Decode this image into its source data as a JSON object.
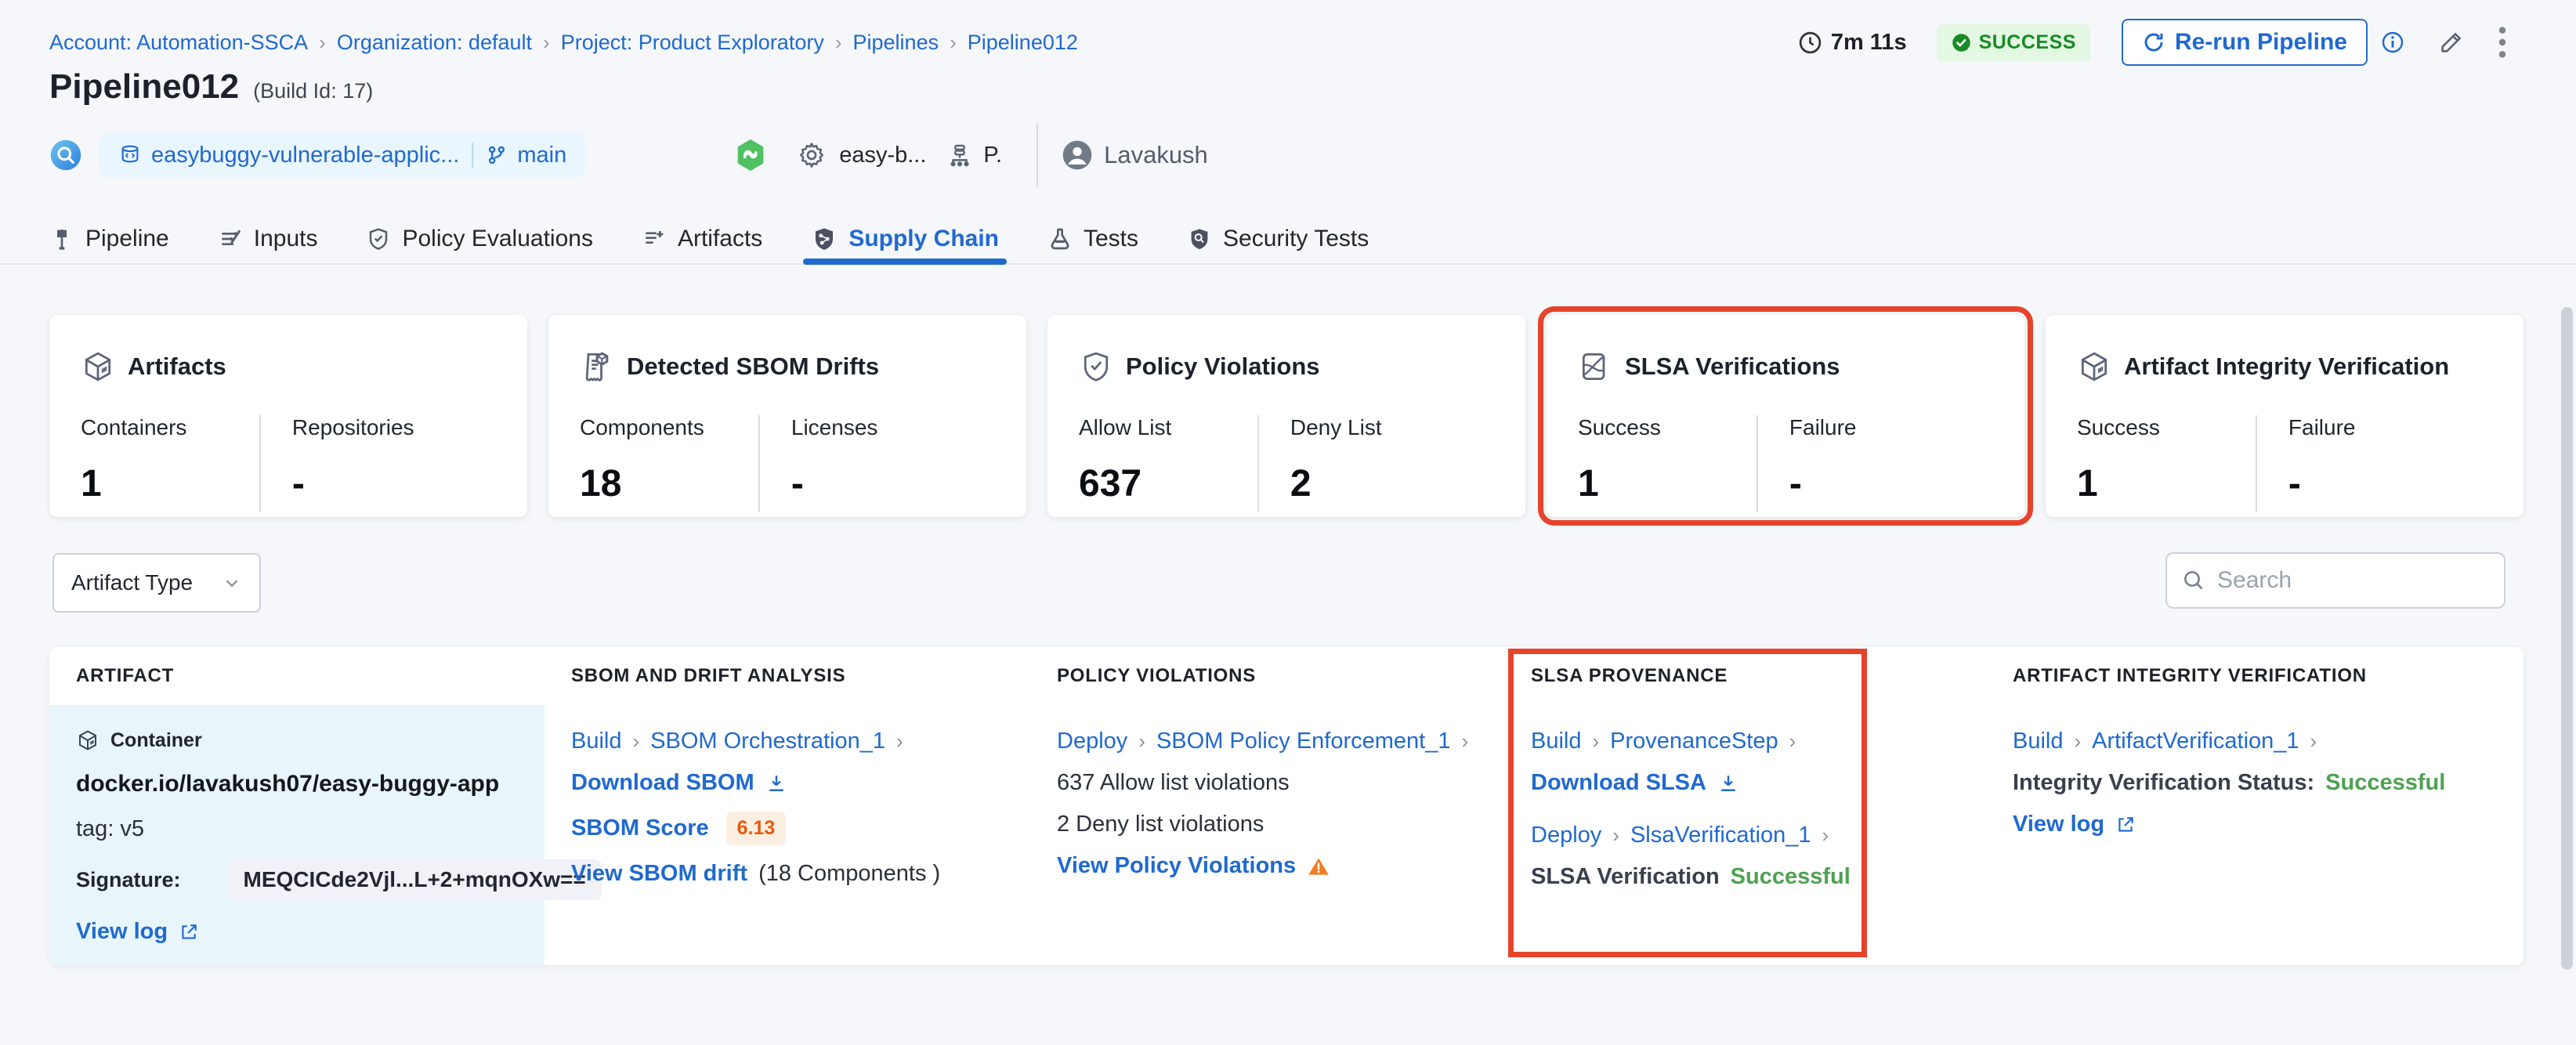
{
  "colors": {
    "highlight_red": "#e5442b",
    "link_blue": "#2069cf",
    "success_badge_green": "#188a26",
    "status_green": "#4ea152",
    "score_orange": "#e8590c",
    "artifact_cell_bg": "#e8f6fb"
  },
  "header": {
    "breadcrumb": [
      {
        "label": "Account: Automation-SSCA"
      },
      {
        "label": "Organization: default"
      },
      {
        "label": "Project: Product Exploratory"
      },
      {
        "label": "Pipelines"
      },
      {
        "label": "Pipeline012"
      }
    ],
    "duration": "7m 11s",
    "status_badge": "SUCCESS",
    "rerun_button": "Re-run Pipeline",
    "title": "Pipeline012",
    "build_id": "(Build Id: 17)",
    "repo": {
      "name": "easybuggy-vulnerable-applic...",
      "branch": "main"
    },
    "execution": {
      "pipeline_short": "easy-b...",
      "project_short": "P.",
      "user": "Lavakush"
    }
  },
  "tabs": [
    {
      "label": "Pipeline"
    },
    {
      "label": "Inputs"
    },
    {
      "label": "Policy Evaluations"
    },
    {
      "label": "Artifacts"
    },
    {
      "label": "Supply Chain"
    },
    {
      "label": "Tests"
    },
    {
      "label": "Security Tests"
    }
  ],
  "summary_cards": [
    {
      "title": "Artifacts",
      "stats": [
        {
          "label": "Containers",
          "value": "1"
        },
        {
          "label": "Repositories",
          "value": "-"
        }
      ]
    },
    {
      "title": "Detected SBOM Drifts",
      "stats": [
        {
          "label": "Components",
          "value": "18"
        },
        {
          "label": "Licenses",
          "value": "-"
        }
      ]
    },
    {
      "title": "Policy Violations",
      "stats": [
        {
          "label": "Allow List",
          "value": "637"
        },
        {
          "label": "Deny List",
          "value": "2"
        }
      ]
    },
    {
      "title": "SLSA Verifications",
      "highlighted": true,
      "stats": [
        {
          "label": "Success",
          "value": "1"
        },
        {
          "label": "Failure",
          "value": "-"
        }
      ]
    },
    {
      "title": "Artifact Integrity Verification",
      "stats": [
        {
          "label": "Success",
          "value": "1"
        },
        {
          "label": "Failure",
          "value": "-"
        }
      ]
    }
  ],
  "filters": {
    "artifact_type_label": "Artifact Type",
    "search_placeholder": "Search"
  },
  "table": {
    "columns": [
      "ARTIFACT",
      "SBOM AND DRIFT ANALYSIS",
      "POLICY VIOLATIONS",
      "SLSA PROVENANCE",
      "ARTIFACT INTEGRITY VERIFICATION"
    ],
    "row": {
      "artifact": {
        "type": "Container",
        "image": "docker.io/lavakush07/easy-buggy-app",
        "tag": "tag: v5",
        "signature_label": "Signature:",
        "signature": "MEQCICde2Vjl...L+2+mqnOXw==",
        "view_log": "View log"
      },
      "sbom": {
        "stage": "Build",
        "step": "SBOM Orchestration_1",
        "download": "Download SBOM",
        "score_label": "SBOM Score",
        "score": "6.13",
        "drift_link": "View SBOM drift",
        "drift_note": "(18 Components )"
      },
      "policy": {
        "stage": "Deploy",
        "step": "SBOM Policy Enforcement_1",
        "allow": "637 Allow list violations",
        "deny": "2 Deny list violations",
        "view_link": "View Policy Violations"
      },
      "slsa": {
        "stage1": "Build",
        "step1": "ProvenanceStep",
        "download": "Download SLSA",
        "stage2": "Deploy",
        "step2": "SlsaVerification_1",
        "status_label": "SLSA Verification",
        "status_value": "Successful"
      },
      "integrity": {
        "stage": "Build",
        "step": "ArtifactVerification_1",
        "status_label": "Integrity Verification Status:",
        "status_value": "Successful",
        "view_log": "View log"
      }
    }
  }
}
